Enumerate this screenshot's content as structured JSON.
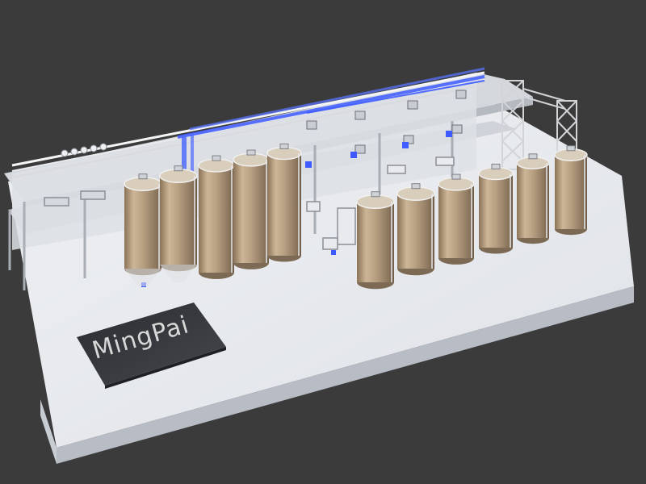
{
  "scene": {
    "background_color": "#3b3b3b",
    "platform_color": "#e4e6ea",
    "tank_color": "#b9a184",
    "pipe_highlight_color": "#3d5bff",
    "structure_color": "#c9ccd2",
    "logo_text": "MingPai",
    "tanks": {
      "silo_row_count": 5,
      "fermenter_row_count": 6
    }
  }
}
